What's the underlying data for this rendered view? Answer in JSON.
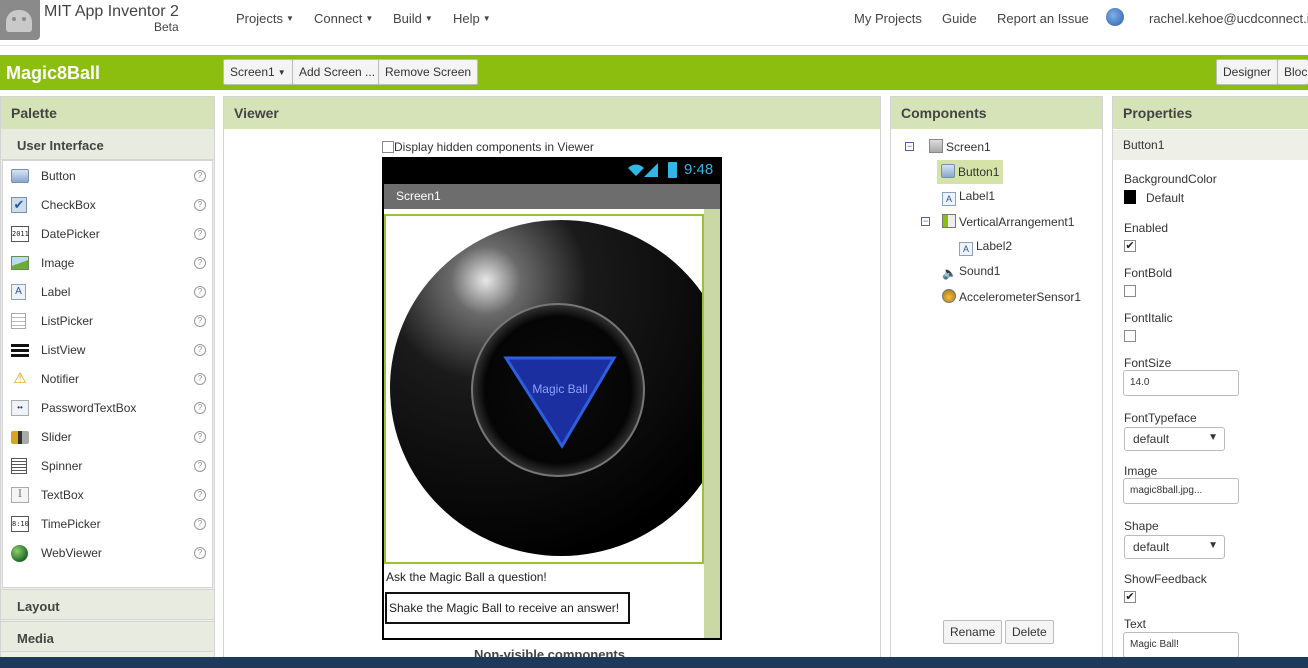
{
  "header": {
    "app_title": "MIT App Inventor 2",
    "app_subtitle": "Beta",
    "menus": [
      {
        "label": "Projects"
      },
      {
        "label": "Connect"
      },
      {
        "label": "Build"
      },
      {
        "label": "Help"
      }
    ],
    "links": [
      {
        "label": "My Projects"
      },
      {
        "label": "Guide"
      },
      {
        "label": "Report an Issue"
      }
    ],
    "user_email": "rachel.kehoe@ucdconnect.ie"
  },
  "toolbar": {
    "project_name": "Magic8Ball",
    "screen_select": "Screen1",
    "add_screen": "Add Screen ...",
    "remove_screen": "Remove Screen",
    "designer": "Designer",
    "blocks": "Blocks"
  },
  "palette": {
    "title": "Palette",
    "category_user_interface": "User Interface",
    "items": [
      {
        "label": "Button",
        "icon": "button-icon"
      },
      {
        "label": "CheckBox",
        "icon": "checkbox-icon"
      },
      {
        "label": "DatePicker",
        "icon": "datepicker-icon"
      },
      {
        "label": "Image",
        "icon": "image-icon"
      },
      {
        "label": "Label",
        "icon": "label-icon"
      },
      {
        "label": "ListPicker",
        "icon": "listpicker-icon"
      },
      {
        "label": "ListView",
        "icon": "listview-icon"
      },
      {
        "label": "Notifier",
        "icon": "notifier-icon"
      },
      {
        "label": "PasswordTextBox",
        "icon": "passwordtextbox-icon"
      },
      {
        "label": "Slider",
        "icon": "slider-icon"
      },
      {
        "label": "Spinner",
        "icon": "spinner-icon"
      },
      {
        "label": "TextBox",
        "icon": "textbox-icon"
      },
      {
        "label": "TimePicker",
        "icon": "timepicker-icon"
      },
      {
        "label": "WebViewer",
        "icon": "webviewer-icon"
      }
    ],
    "help_glyph": "?",
    "category_layout": "Layout",
    "category_media": "Media"
  },
  "viewer": {
    "title": "Viewer",
    "display_hidden_label": "Display hidden components in Viewer",
    "status_time": "9:48",
    "screen_title": "Screen1",
    "ball_text": "Magic Ball",
    "label1_text": "Ask the Magic Ball a question!",
    "label2_text": "Shake the Magic Ball to receive an answer!",
    "non_visible_label": "Non-visible components"
  },
  "components": {
    "title": "Components",
    "tree": {
      "screen1": "Screen1",
      "button1": "Button1",
      "label1": "Label1",
      "vertical_arrangement1": "VerticalArrangement1",
      "label2": "Label2",
      "sound1": "Sound1",
      "accelerometer1": "AccelerometerSensor1"
    },
    "rename": "Rename",
    "delete": "Delete"
  },
  "properties": {
    "title": "Properties",
    "selected_component": "Button1",
    "background_color_label": "BackgroundColor",
    "background_color_value": "Default",
    "enabled_label": "Enabled",
    "fontbold_label": "FontBold",
    "fontitalic_label": "FontItalic",
    "fontsize_label": "FontSize",
    "fontsize_value": "14.0",
    "fonttypeface_label": "FontTypeface",
    "fonttypeface_value": "default",
    "image_label": "Image",
    "image_value": "magic8ball.jpg...",
    "shape_label": "Shape",
    "shape_value": "default",
    "showfeedback_label": "ShowFeedback",
    "text_label": "Text",
    "text_value": "Magic Ball!",
    "enabled_checked": true,
    "fontbold_checked": false,
    "fontitalic_checked": false,
    "showfeedback_checked": true
  },
  "colors": {
    "brand_green": "#8cbe0f",
    "panel_header": "#d6e3b8",
    "selected_tree_item": "#d6e3a8"
  }
}
